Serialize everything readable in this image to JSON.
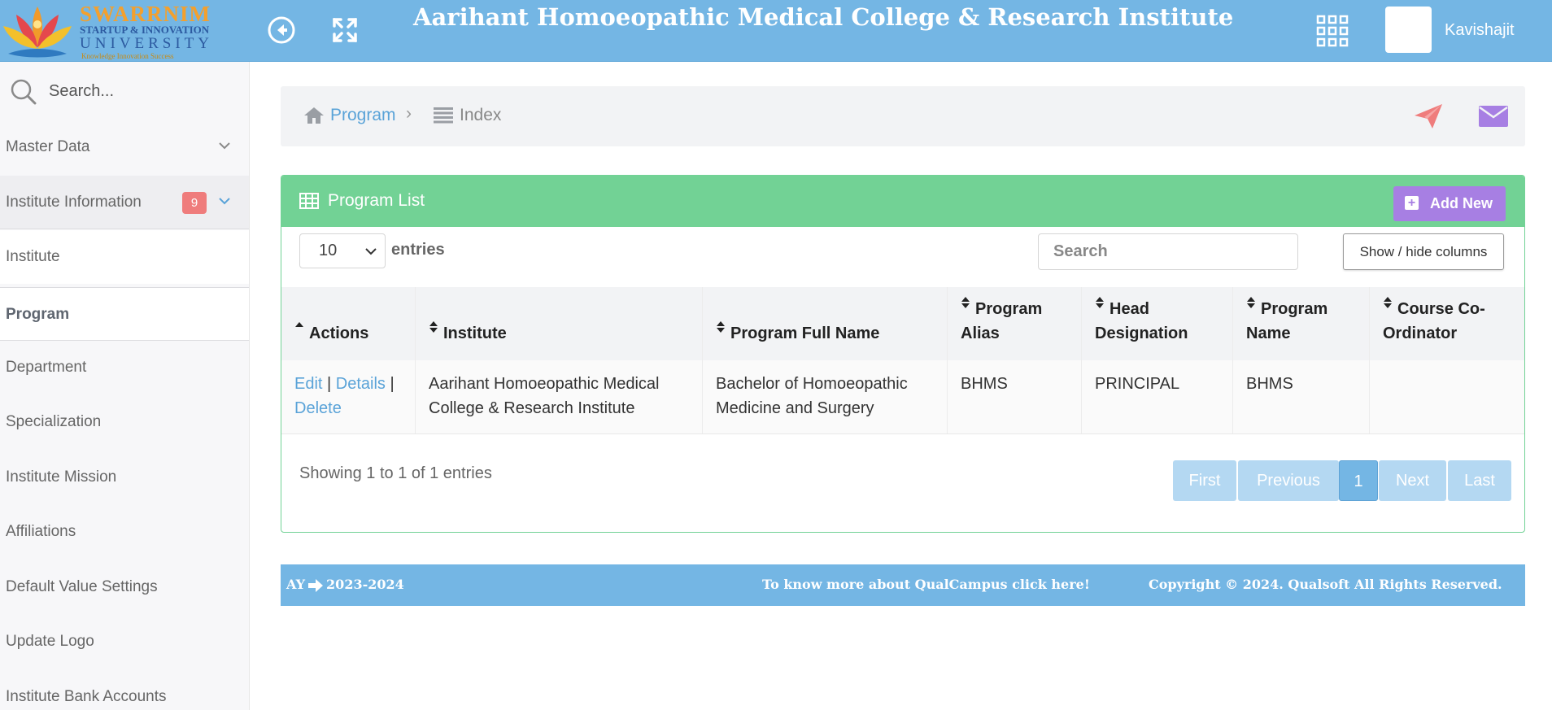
{
  "header": {
    "logo": {
      "name": "SWARRNIM",
      "line2": "STARTUP & INNOVATION",
      "line3": "UNIVERSITY",
      "tagline": "Knowledge Innovation Success"
    },
    "title": "Aarihant Homoeopathic Medical College & Research Institute",
    "username": "Kavishajit",
    "icons": [
      "back-circle-icon",
      "fullscreen-icon",
      "apps-grid-icon"
    ]
  },
  "sidebar": {
    "search_placeholder": "Search...",
    "items": [
      {
        "label": "Master Data"
      },
      {
        "label": "Institute Information",
        "badge": "9"
      },
      {
        "label": "Institute"
      },
      {
        "label": "Program"
      },
      {
        "label": "Department"
      },
      {
        "label": "Specialization"
      },
      {
        "label": "Institute Mission"
      },
      {
        "label": "Affiliations"
      },
      {
        "label": "Default Value Settings"
      },
      {
        "label": "Update Logo"
      },
      {
        "label": "Institute Bank Accounts"
      }
    ]
  },
  "breadcrumb": {
    "home": "Program",
    "current": "Index"
  },
  "card": {
    "title": "Program List",
    "add_label": "Add New",
    "page_length": "10",
    "entries_label": "entries",
    "search_placeholder": "Search",
    "colvis_label": "Show / hide columns",
    "columns": [
      "Actions",
      "Institute",
      "Program Full Name",
      "Program Alias",
      "Head Designation",
      "Program Name",
      "Course Co-Ordinator"
    ],
    "rows": [
      {
        "actions": {
          "edit": "Edit",
          "details": "Details",
          "delete": "Delete"
        },
        "institute": "Aarihant Homoeopathic Medical College & Research Institute",
        "program_full_name": "Bachelor of Homoeopathic Medicine and Surgery",
        "program_alias": "BHMS",
        "head_designation": "PRINCIPAL",
        "program_name": "BHMS",
        "course_coordinator": ""
      }
    ],
    "info": "Showing 1 to 1 of 1 entries",
    "pager": {
      "first": "First",
      "previous": "Previous",
      "current": "1",
      "next": "Next",
      "last": "Last"
    }
  },
  "footer": {
    "ay_label": "AY",
    "ay_value": "2023-2024",
    "qualcampus": "To know more about QualCampus click here!",
    "copyright": "Copyright © 2024. Qualsoft All Rights Reserved."
  },
  "colors": {
    "topbar": "#74b6e4",
    "card_header": "#72d295",
    "add_button": "#a77fe3",
    "badge": "#ef7c7c",
    "link": "#5aa3d8",
    "paper_plane": "#ef7c7c",
    "mail": "#a77fe3"
  }
}
